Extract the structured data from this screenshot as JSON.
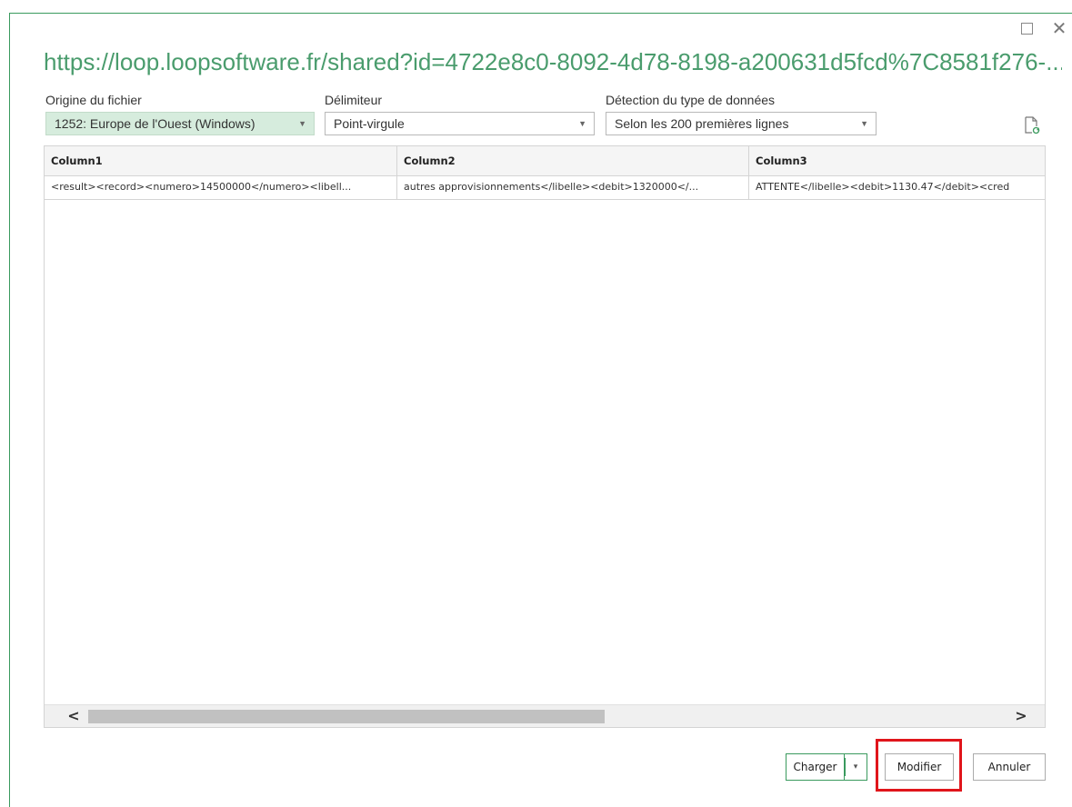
{
  "window": {
    "title": "https://loop.loopsoftware.fr/shared?id=4722e8c0-8092-4d78-8198-a200631d5fcd%7C8581f276-...",
    "maximize_icon": "maximize-icon",
    "close_icon": "close-icon",
    "close_glyph": "✕"
  },
  "options": {
    "file_origin": {
      "label": "Origine du fichier",
      "value": "1252: Europe de l'Ouest (Windows)"
    },
    "delimiter": {
      "label": "Délimiteur",
      "value": "Point-virgule"
    },
    "type_detection": {
      "label": "Détection du type de données",
      "value": "Selon les 200 premières lignes"
    },
    "refresh_icon": "refresh-document-icon"
  },
  "preview": {
    "columns": [
      "Column1",
      "Column2",
      "Column3"
    ],
    "rows": [
      [
        "<result><record><numero>14500000</numero><libell...",
        "autres approvisionnements</libelle><debit>1320000</...",
        "ATTENTE</libelle><debit>1130.47</debit><cred"
      ]
    ],
    "scroll_left": "<",
    "scroll_right": ">"
  },
  "footer": {
    "load_label": "Charger",
    "load_split_glyph": "▾",
    "edit_label": "Modifier",
    "cancel_label": "Annuler"
  },
  "colors": {
    "accent_green": "#4a9c6d",
    "highlight_red": "#e0151b"
  }
}
